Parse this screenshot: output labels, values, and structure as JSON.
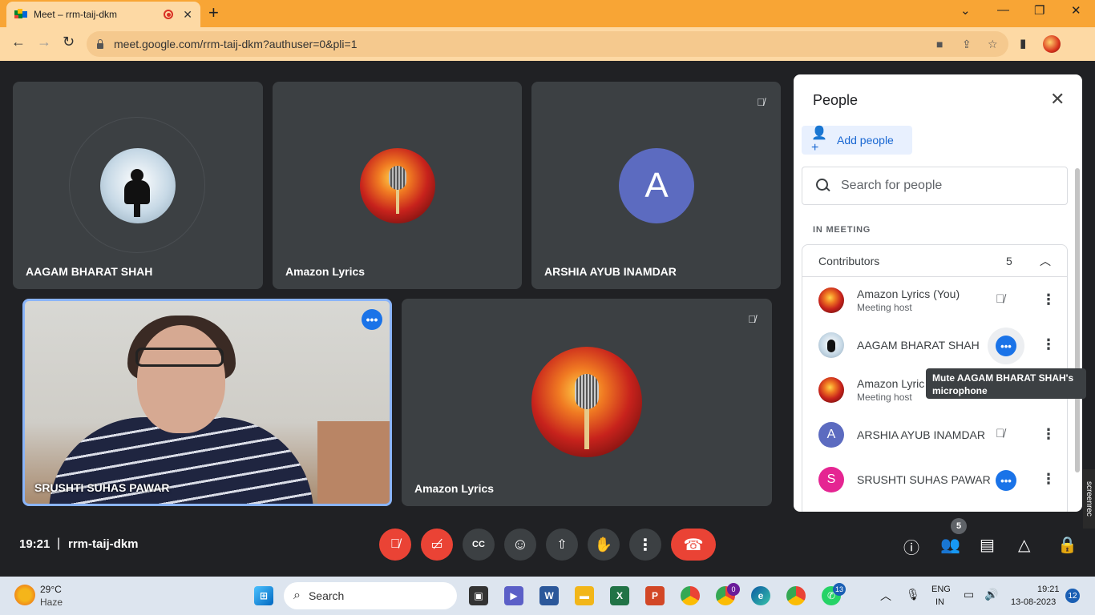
{
  "browser": {
    "tab_title": "Meet – rrm-taij-dkm",
    "tab_close": "✕",
    "new_tab": "+",
    "url": "meet.google.com/rrm-taij-dkm?authuser=0&pli=1",
    "window_controls": [
      "⌄",
      "—",
      "❐",
      "✕"
    ]
  },
  "tiles": [
    {
      "name": "AAGAM BHARAT SHAH",
      "avatar": "itachi-avatar"
    },
    {
      "name": "Amazon Lyrics",
      "avatar": "microphone-avatar"
    },
    {
      "name": "ARSHIA AYUB INAMDAR",
      "avatar_letter": "A",
      "muted": true
    },
    {
      "name": "SRUSHTI SUHAS PAWAR",
      "avatar": "video"
    },
    {
      "name": "Amazon Lyrics",
      "avatar": "microphone-avatar",
      "muted": true
    }
  ],
  "panel": {
    "title": "People",
    "add_people": "Add people",
    "search_placeholder": "Search for people",
    "section": "IN MEETING",
    "group_label": "Contributors",
    "group_count": "5",
    "participants": [
      {
        "name": "Amazon Lyrics (You)",
        "role": "Meeting host",
        "mic": "muted",
        "avatar": "microphone"
      },
      {
        "name": "AAGAM BHARAT SHAH",
        "role": "",
        "mic": "speaking",
        "avatar": "itachi"
      },
      {
        "name": "Amazon Lyrics",
        "role": "Meeting host",
        "mic": "hidden",
        "avatar": "microphone"
      },
      {
        "name": "ARSHIA AYUB INAMDAR",
        "role": "",
        "mic": "muted",
        "avatar_letter": "A",
        "avatar_color": "#5c6bc0"
      },
      {
        "name": "SRUSHTI SUHAS PAWAR",
        "role": "",
        "mic": "speaking",
        "avatar_letter": "S",
        "avatar_color": "#e52592"
      }
    ],
    "tooltip": "Mute AAGAM BHARAT SHAH's microphone"
  },
  "bottom_bar": {
    "time": "19:21",
    "separator": "|",
    "meeting_code": "rrm-taij-dkm",
    "people_badge": "5"
  },
  "screenrec": "screenrec",
  "taskbar": {
    "temperature": "29°C",
    "weather": "Haze",
    "search": "Search",
    "lang": "ENG",
    "region": "IN",
    "clock": "19:21",
    "date": "13-08-2023",
    "notifications": "12",
    "opera_badge": "0",
    "whatsapp_badge": "13"
  },
  "colors": {
    "tabbar": "#f8a535",
    "meet_bg": "#202124",
    "tile": "#3c4043",
    "accent": "#1a73e8",
    "danger": "#ea4335"
  }
}
